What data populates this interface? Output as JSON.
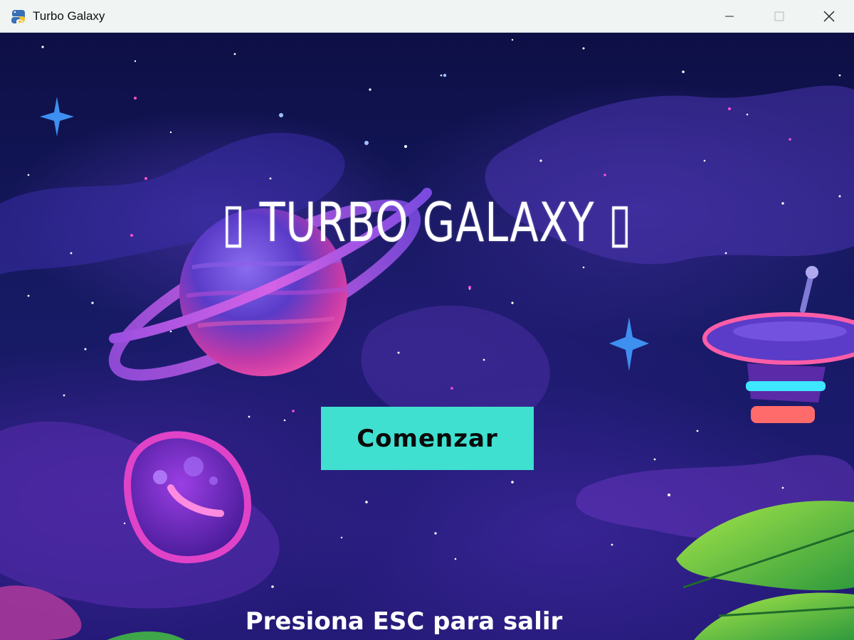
{
  "window": {
    "title": "Turbo Galaxy",
    "app_icon": "snake-icon",
    "controls": [
      "minimize-icon",
      "maximize-icon",
      "close-icon"
    ]
  },
  "game": {
    "title": "▯ TURBO GALAXY ▯",
    "start_button_label": "Comenzar",
    "exit_hint": "Presiona ESC para salir"
  },
  "colors": {
    "button": "#40e0d0",
    "background": "#161a63",
    "title_text": "#ffffff"
  }
}
